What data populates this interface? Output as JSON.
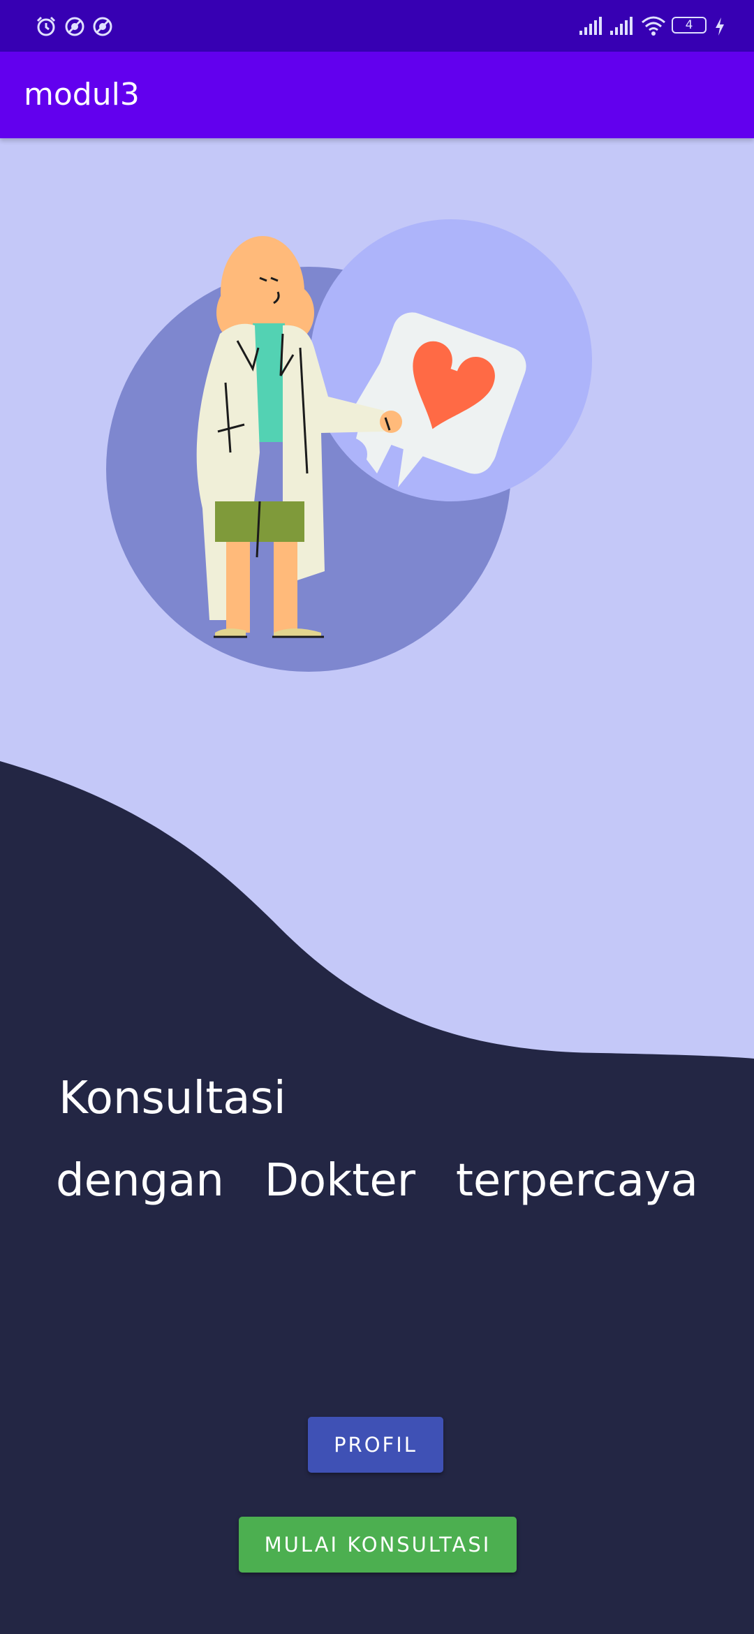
{
  "status_bar": {
    "left_icons": [
      "alarm-icon",
      "dnd-icon",
      "dnd-icon"
    ],
    "right_icons": [
      "signal-icon",
      "signal-icon",
      "wifi-icon",
      "battery-icon",
      "charging-icon"
    ],
    "battery_level": "4",
    "background": "#3700b3"
  },
  "app_bar": {
    "title": "modul3",
    "background": "#6200ee"
  },
  "hero": {
    "top_background": "#c4c8f8",
    "bottom_background": "#232644"
  },
  "headline": {
    "line1": "Konsultasi",
    "line2_words": [
      "dengan",
      "Dokter",
      "terpercaya"
    ]
  },
  "buttons": {
    "profil": "PROFIL",
    "mulai": "MULAI KONSULTASI"
  },
  "colors": {
    "profil_button": "#3f51b5",
    "mulai_button": "#4caf50"
  }
}
